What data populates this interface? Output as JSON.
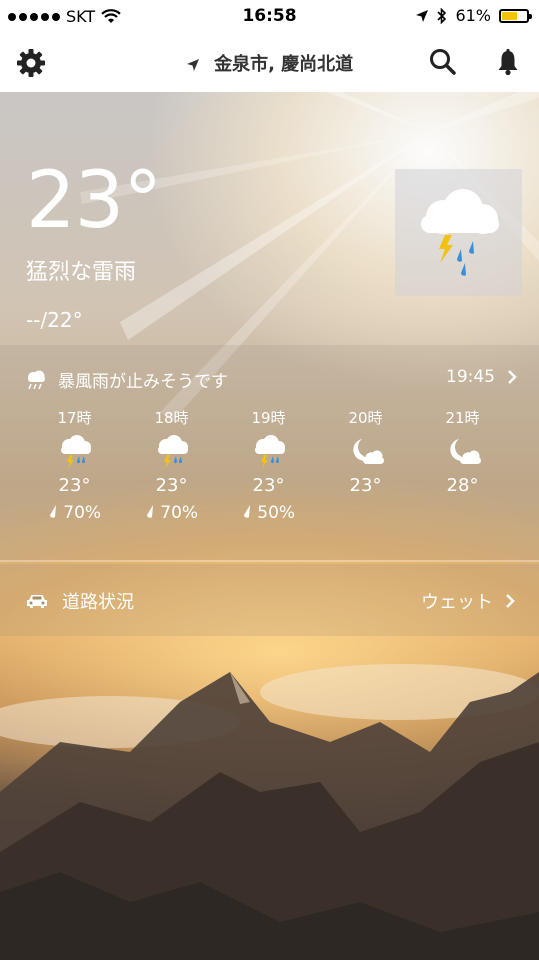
{
  "status_bar": {
    "carrier": "SKT",
    "time": "16:58",
    "battery_percent_label": "61%",
    "battery_level": 0.61,
    "battery_color": "#f2c20f"
  },
  "nav": {
    "location": "金泉市, 慶尚北道",
    "icons": [
      "gear-icon",
      "location-arrow-icon",
      "search-icon",
      "bell-icon"
    ]
  },
  "current": {
    "temperature": "23°",
    "condition": "猛烈な雷雨",
    "hilo": "--/22°",
    "icon": "thunderstorm-icon"
  },
  "forecast": {
    "headline": "暴風雨が止みそうです",
    "time": "19:45",
    "hours": [
      {
        "hour": "17時",
        "icon": "thunderstorm-icon",
        "temp": "23°",
        "precip": "70%"
      },
      {
        "hour": "18時",
        "icon": "thunderstorm-icon",
        "temp": "23°",
        "precip": "70%"
      },
      {
        "hour": "19時",
        "icon": "thunderstorm-icon",
        "temp": "23°",
        "precip": "50%"
      },
      {
        "hour": "20時",
        "icon": "moon-cloud-icon",
        "temp": "23°",
        "precip": ""
      },
      {
        "hour": "21時",
        "icon": "moon-cloud-icon",
        "temp": "28°",
        "precip": ""
      }
    ]
  },
  "road": {
    "label": "道路状況",
    "status": "ウェット"
  }
}
